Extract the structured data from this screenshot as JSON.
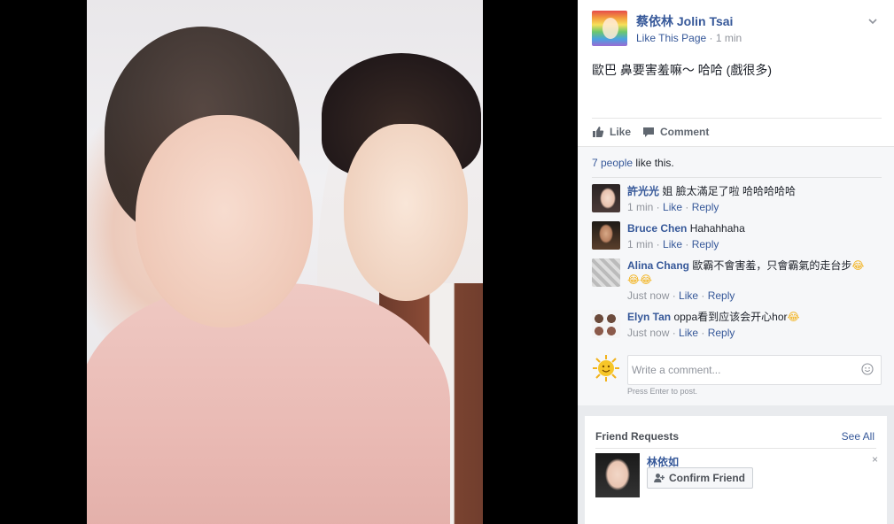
{
  "post": {
    "page_name": "蔡依林 Jolin Tsai",
    "like_page": "Like This Page",
    "time_sep": " · ",
    "time": "1 min",
    "text": "歐巴 鼻要害羞嘛～ 哈哈 (戲很多)"
  },
  "actions": {
    "like": "Like",
    "comment": "Comment"
  },
  "likes": {
    "people": "7 people",
    "rest": " like this."
  },
  "comments": [
    {
      "author": "許光光",
      "text": " 姐 臉太滿足了啦 哈哈哈哈哈",
      "time": "1 min",
      "like": "Like",
      "reply": "Reply"
    },
    {
      "author": "Bruce Chen",
      "text": " Hahahhaha",
      "time": "1 min",
      "like": "Like",
      "reply": "Reply"
    },
    {
      "author": "Alina Chang",
      "text": " 歐霸不會害羞，只會霸氣的走台步",
      "emoji": "😂",
      "emoji2": "😂😂",
      "time": "Just now",
      "like": "Like",
      "reply": "Reply"
    },
    {
      "author": "Elyn Tan",
      "text": " oppa看到应该会开心hor",
      "emoji": "😂",
      "time": "Just now",
      "like": "Like",
      "reply": "Reply"
    }
  ],
  "composer": {
    "placeholder": "Write a comment...",
    "hint": "Press Enter to post."
  },
  "friend_requests": {
    "title": "Friend Requests",
    "see_all": "See All",
    "name": "林依如",
    "confirm": "Confirm Friend",
    "close": "×"
  },
  "icons": [
    "chevron-down-icon",
    "thumbs-up-icon",
    "comment-bubble-icon",
    "smiley-icon",
    "sun-avatar-icon",
    "add-friend-icon",
    "close-icon"
  ],
  "colors": {
    "link": "#365899",
    "muted": "#90949c",
    "ufi_bg": "#f6f7f9"
  }
}
